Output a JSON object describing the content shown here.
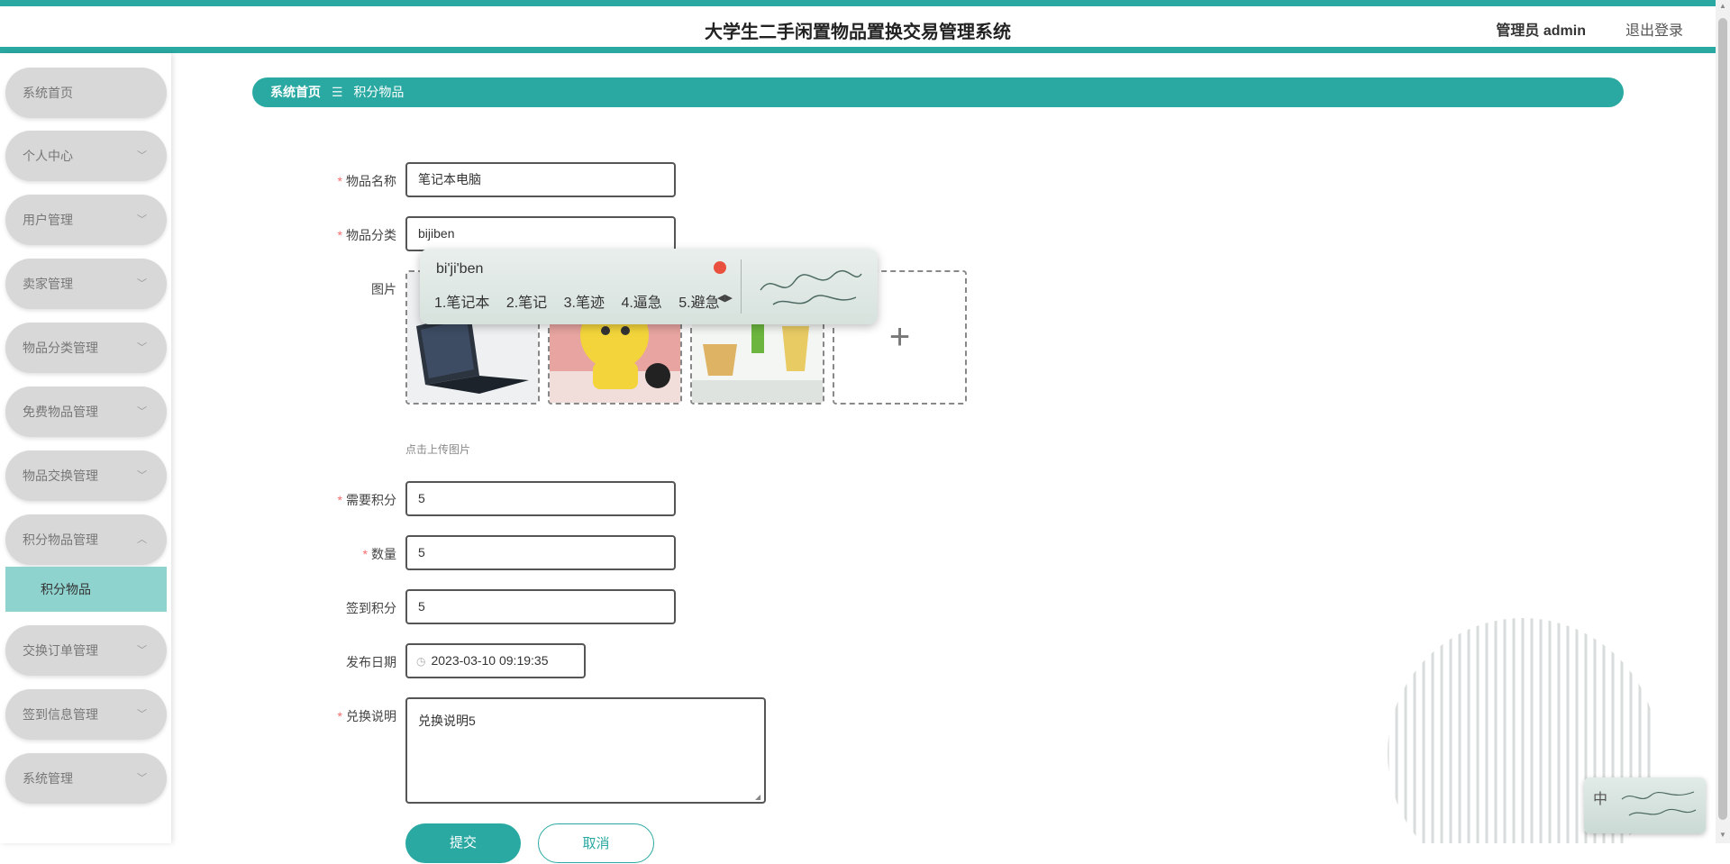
{
  "header": {
    "title": "大学生二手闲置物品置换交易管理系统",
    "admin_label": "管理员 admin",
    "logout_label": "退出登录"
  },
  "sidebar": {
    "items": [
      {
        "label": "系统首页"
      },
      {
        "label": "个人中心"
      },
      {
        "label": "用户管理"
      },
      {
        "label": "卖家管理"
      },
      {
        "label": "物品分类管理"
      },
      {
        "label": "免费物品管理"
      },
      {
        "label": "物品交换管理"
      },
      {
        "label": "积分物品管理"
      },
      {
        "label": "交换订单管理"
      },
      {
        "label": "签到信息管理"
      },
      {
        "label": "系统管理"
      }
    ],
    "subitem": "积分物品"
  },
  "breadcrumb": {
    "home": "系统首页",
    "separator": "☰",
    "current": "积分物品"
  },
  "form": {
    "name_label": "物品名称",
    "name_value": "笔记本电脑",
    "category_label": "物品分类",
    "category_value": "bijiben",
    "image_label": "图片",
    "upload_hint": "点击上传图片",
    "points_label": "需要积分",
    "points_value": "5",
    "quantity_label": "数量",
    "quantity_value": "5",
    "signin_label": "签到积分",
    "signin_value": "5",
    "date_label": "发布日期",
    "date_value": "2023-03-10 09:19:35",
    "desc_label": "兑换说明",
    "desc_value": "兑换说明5",
    "submit_label": "提交",
    "cancel_label": "取消",
    "required_mark": "*"
  },
  "ime": {
    "composition": "bi'ji'ben",
    "candidates": [
      "1.笔记本",
      "2.笔记",
      "3.笔迹",
      "4.逼急",
      "5.避急"
    ],
    "mode": "中"
  },
  "colors": {
    "accent": "#2aa9a2",
    "submenu_active": "#8fd3cf",
    "menu_bg": "#d8d8d8",
    "required": "#f56c6c"
  }
}
